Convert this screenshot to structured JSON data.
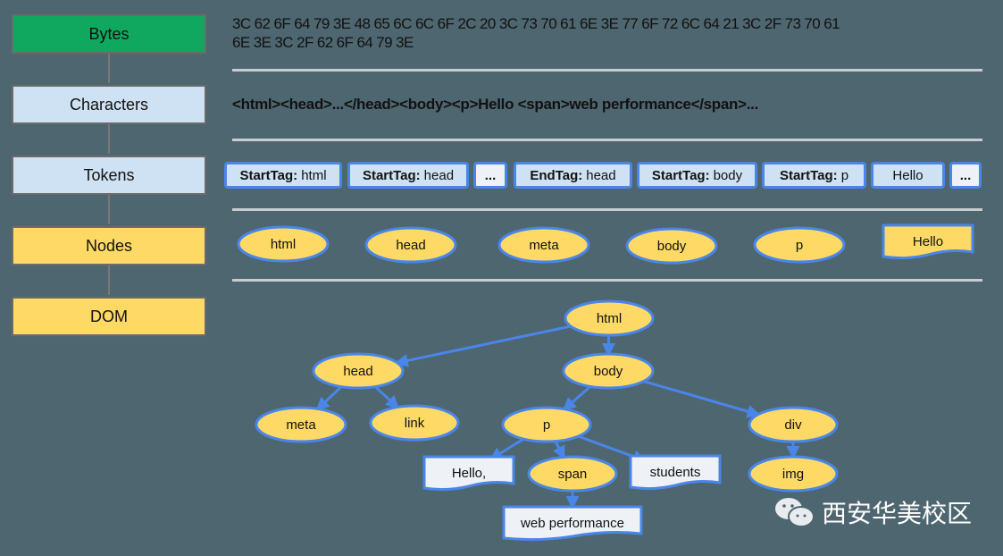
{
  "stages": [
    {
      "label": "Bytes",
      "color": "green"
    },
    {
      "label": "Characters",
      "color": "blue"
    },
    {
      "label": "Tokens",
      "color": "blue"
    },
    {
      "label": "Nodes",
      "color": "yellow"
    },
    {
      "label": "DOM",
      "color": "yellow"
    }
  ],
  "bytes_line1": "3C 62 6F 64 79 3E 48 65 6C 6C 6F 2C 20 3C 73 70 61 6E 3E 77 6F 72 6C 64 21 3C 2F 73 70 61",
  "bytes_line2": "6E 3E 3C 2F 62 6F 64 79 3E",
  "characters": "<html><head>...</head><body><p>Hello <span>web performance</span>...",
  "tokens": [
    {
      "kind": "StartTag:",
      "value": "html"
    },
    {
      "kind": "StartTag:",
      "value": "head"
    },
    {
      "kind": "",
      "value": "..."
    },
    {
      "kind": "EndTag:",
      "value": "head"
    },
    {
      "kind": "StartTag:",
      "value": "body"
    },
    {
      "kind": "StartTag:",
      "value": "p"
    },
    {
      "kind": "",
      "value": "Hello"
    },
    {
      "kind": "",
      "value": "..."
    }
  ],
  "nodes": [
    {
      "label": "html",
      "shape": "ellipse"
    },
    {
      "label": "head",
      "shape": "ellipse"
    },
    {
      "label": "meta",
      "shape": "ellipse"
    },
    {
      "label": "body",
      "shape": "ellipse"
    },
    {
      "label": "p",
      "shape": "ellipse"
    },
    {
      "label": "Hello",
      "shape": "text"
    }
  ],
  "dom_tree": {
    "nodes": [
      {
        "id": "html",
        "label": "html",
        "shape": "ellipse"
      },
      {
        "id": "head",
        "label": "head",
        "shape": "ellipse"
      },
      {
        "id": "body",
        "label": "body",
        "shape": "ellipse"
      },
      {
        "id": "meta",
        "label": "meta",
        "shape": "ellipse"
      },
      {
        "id": "link",
        "label": "link",
        "shape": "ellipse"
      },
      {
        "id": "p",
        "label": "p",
        "shape": "ellipse"
      },
      {
        "id": "div",
        "label": "div",
        "shape": "ellipse"
      },
      {
        "id": "hello",
        "label": "Hello,",
        "shape": "text"
      },
      {
        "id": "span",
        "label": "span",
        "shape": "ellipse"
      },
      {
        "id": "students",
        "label": "students",
        "shape": "text"
      },
      {
        "id": "img",
        "label": "img",
        "shape": "ellipse"
      },
      {
        "id": "webperf",
        "label": "web performance",
        "shape": "text"
      }
    ],
    "edges": [
      [
        "html",
        "head"
      ],
      [
        "html",
        "body"
      ],
      [
        "head",
        "meta"
      ],
      [
        "head",
        "link"
      ],
      [
        "body",
        "p"
      ],
      [
        "body",
        "div"
      ],
      [
        "p",
        "hello"
      ],
      [
        "p",
        "span"
      ],
      [
        "p",
        "students"
      ],
      [
        "span",
        "webperf"
      ],
      [
        "div",
        "img"
      ]
    ]
  },
  "colors": {
    "background": "#4e6670",
    "node_fill": "#ffd966",
    "edge": "#4a86e8",
    "token_fill": "#cfe2f3",
    "text_fill": "#eef1f6",
    "bytes_fill": "#10a85e"
  },
  "watermark": "西安华美校区"
}
